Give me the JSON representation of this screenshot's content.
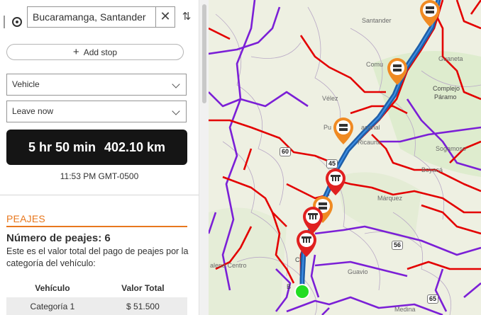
{
  "stops": {
    "destination_value": "Bucaramanga, Santander",
    "clear_glyph": "✕",
    "swap_glyph": "⇅"
  },
  "add_stop": {
    "plus": "+",
    "label": "Add stop"
  },
  "travel_mode": {
    "selected": "Vehicle"
  },
  "departure": {
    "selected": "Leave now"
  },
  "summary": {
    "duration": "5 hr 50 min",
    "distance": "402.10 km"
  },
  "arrival_time": "11:53 PM GMT-0500",
  "peajes": {
    "title": "PEAJES",
    "count_label": "Número de peajes: 6",
    "description": "Este es el valor total del pago de peajes por la categoría del vehículo:",
    "table": {
      "headers": [
        "Vehículo",
        "Valor Total"
      ],
      "rows": [
        [
          "Categoría 1",
          "$ 51.500"
        ]
      ]
    }
  },
  "map": {
    "place_labels": [
      {
        "text": "Santander",
        "kind": "town"
      },
      {
        "text": "Guaneta",
        "kind": "town"
      },
      {
        "text": "Comu",
        "kind": "town"
      },
      {
        "text": "Complejo",
        "kind": "area"
      },
      {
        "text": "Páramo",
        "kind": "area"
      },
      {
        "text": "Vélez",
        "kind": "town"
      },
      {
        "text": "Pu",
        "kind": "town"
      },
      {
        "text": "acanal",
        "kind": "town"
      },
      {
        "text": "Ricaurte",
        "kind": "town"
      },
      {
        "text": "Sogamoso",
        "kind": "town"
      },
      {
        "text": "Boyacá",
        "kind": "area"
      },
      {
        "text": "Márquez",
        "kind": "town"
      },
      {
        "text": "Guavio",
        "kind": "area"
      },
      {
        "text": "Ci",
        "kind": "town"
      },
      {
        "text": "B",
        "kind": "town"
      },
      {
        "text": "Medina",
        "kind": "town"
      },
      {
        "text": "alena Centro",
        "kind": "town"
      }
    ],
    "route_shields": [
      "60",
      "45",
      "56",
      "65"
    ],
    "colors": {
      "route": "#1f5fa8",
      "road_primary": "#e30000",
      "road_secondary": "#7b1fd6",
      "toll_marker_orange": "#f08a22",
      "toll_marker_red": "#e02020",
      "origin": "#22dd22"
    },
    "icons": [
      "toll-booth-icon",
      "origin-point-icon"
    ]
  }
}
